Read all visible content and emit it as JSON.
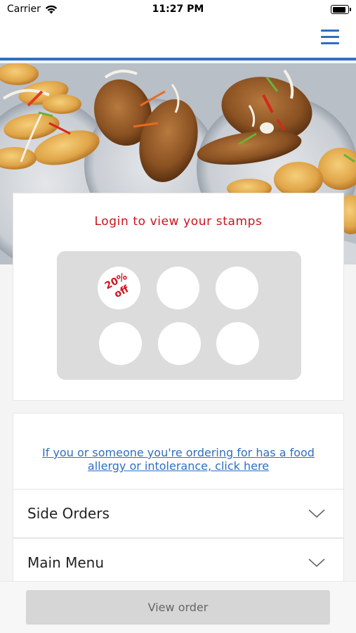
{
  "status_bar": {
    "carrier": "Carrier",
    "time": "11:27 PM",
    "battery_level": 0.9
  },
  "nav": {
    "menu_icon": "hamburger-menu-icon",
    "accent_color": "#2f6fbf"
  },
  "hero": {
    "image": "fried-fish-and-dough-dishes-photo"
  },
  "stamps": {
    "title": "Login to view your stamps",
    "title_color": "#c9141b",
    "reward_text": "20%\noff",
    "slots": 6,
    "collected": 0
  },
  "allergy": {
    "link_text": "If you or someone you're ordering for has a food allergy or intolerance, click here"
  },
  "menu_sections": [
    {
      "label": "Side Orders",
      "icon": "chevron-down-icon"
    },
    {
      "label": "Main Menu",
      "icon": "chevron-down-icon"
    }
  ],
  "footer": {
    "view_order_label": "View order"
  }
}
